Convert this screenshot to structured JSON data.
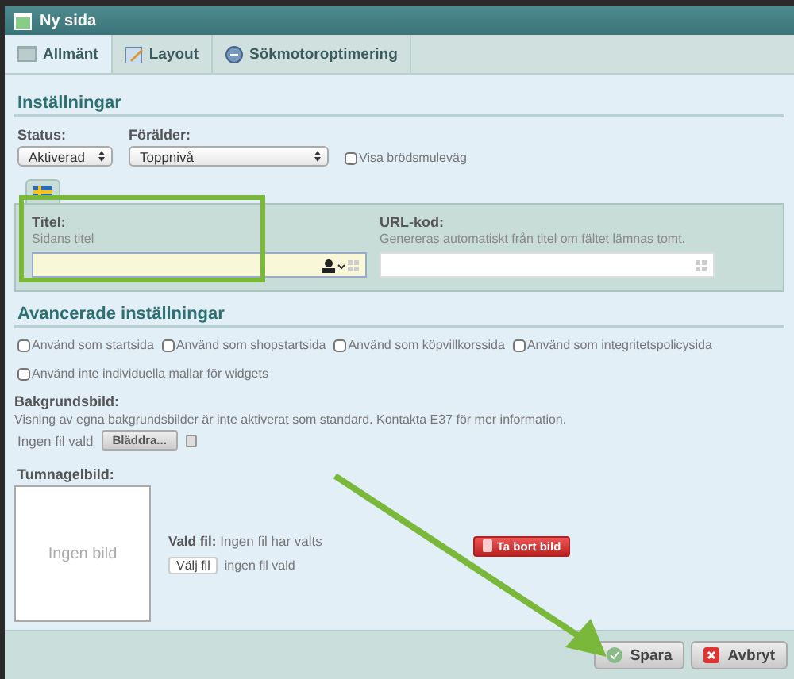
{
  "window": {
    "title": "Ny sida"
  },
  "tabs": [
    {
      "label": "Allmänt",
      "selected": true,
      "kind": "general"
    },
    {
      "label": "Layout",
      "selected": false,
      "kind": "layout"
    },
    {
      "label": "Sökmotoroptimering",
      "selected": false,
      "kind": "seo"
    }
  ],
  "settings": {
    "heading": "Inställningar",
    "status": {
      "label": "Status:",
      "value": "Aktiverad"
    },
    "parent": {
      "label": "Förälder:",
      "value": "Toppnivå"
    },
    "breadcrumb": {
      "label": "Visa brödsmuleväg",
      "checked": false
    },
    "title_field": {
      "label": "Titel:",
      "hint": "Sidans titel"
    },
    "url_field": {
      "label": "URL-kod:",
      "hint": "Genereras automatiskt från titel om fältet lämnas tomt."
    }
  },
  "advanced": {
    "heading": "Avancerade inställningar",
    "options": [
      {
        "label": "Använd som startsida",
        "checked": false
      },
      {
        "label": "Använd som shopstartsida",
        "checked": false
      },
      {
        "label": "Använd som köpvillkorssida",
        "checked": false
      },
      {
        "label": "Använd som integritetspolicysida",
        "checked": false
      },
      {
        "label": "Använd inte individuella mallar för widgets",
        "checked": false
      }
    ],
    "background": {
      "label": "Bakgrundsbild:",
      "note": "Visning av egna bakgrundsbilder är inte aktiverat som standard. Kontakta E37 för mer information.",
      "file_status": "Ingen fil vald",
      "browse_button": "Bläddra..."
    },
    "thumbnail": {
      "label": "Tumnagelbild:",
      "placeholder_text": "Ingen bild",
      "chosen_label": "Vald fil:",
      "chosen_value": "Ingen fil har valts",
      "choose_button": "Välj fil",
      "file_status": "ingen fil vald",
      "remove_button": "Ta bort bild"
    }
  },
  "footer": {
    "buttons": [
      {
        "label": "Spara",
        "kind": "save"
      },
      {
        "label": "Avbryt",
        "kind": "cancel"
      }
    ]
  }
}
